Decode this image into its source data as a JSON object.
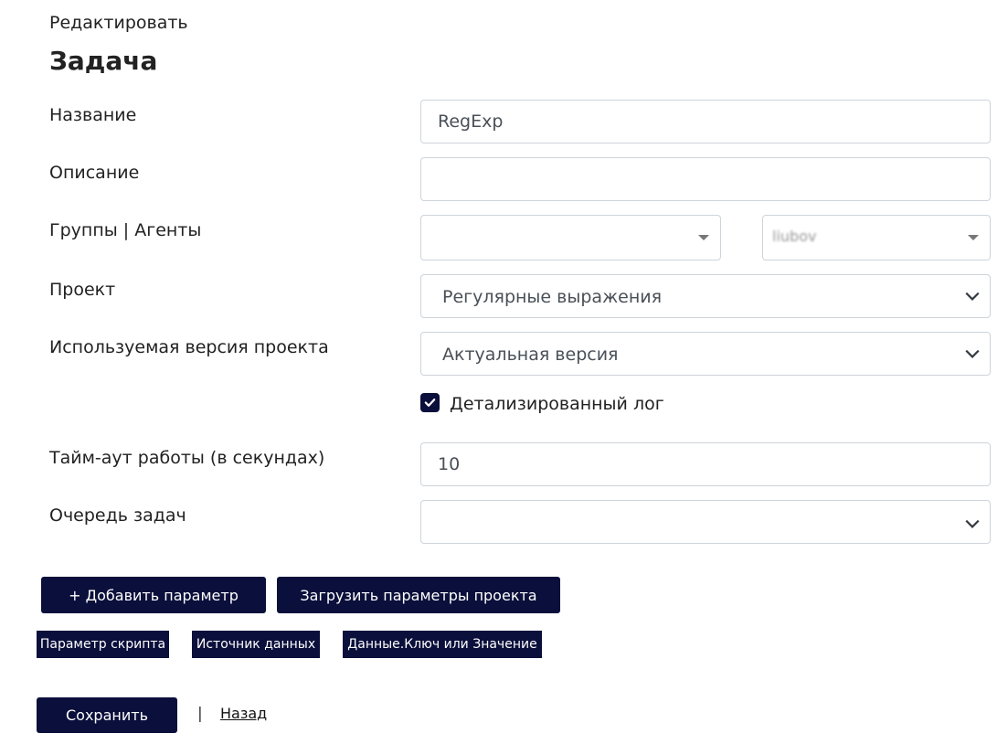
{
  "header": {
    "subtitle": "Редактировать",
    "title": "Задача"
  },
  "form": {
    "name": {
      "label": "Название",
      "value": "RegExp"
    },
    "description": {
      "label": "Описание",
      "value": ""
    },
    "groups_agents": {
      "label": "Группы | Агенты",
      "group_value": "",
      "agent_value": "liubov"
    },
    "project": {
      "label": "Проект",
      "value": "Регулярные выражения"
    },
    "project_version": {
      "label": "Используемая версия проекта",
      "value": "Актуальная версия"
    },
    "detailed_log": {
      "label": "Детализированный лог",
      "checked": true
    },
    "timeout": {
      "label": "Тайм-аут работы (в секундах)",
      "value": "10"
    },
    "task_queue": {
      "label": "Очередь задач",
      "value": ""
    }
  },
  "actions": {
    "add_param": "+ Добавить параметр",
    "load_params": "Загрузить параметры проекта"
  },
  "param_headers": [
    "Параметр скрипта",
    "Источник данных",
    "Данные.Ключ или Значение"
  ],
  "footer": {
    "save": "Сохранить",
    "separator": "|",
    "back": "Назад"
  },
  "colors": {
    "primary": "#0b0f3b",
    "border": "#ced4da"
  }
}
